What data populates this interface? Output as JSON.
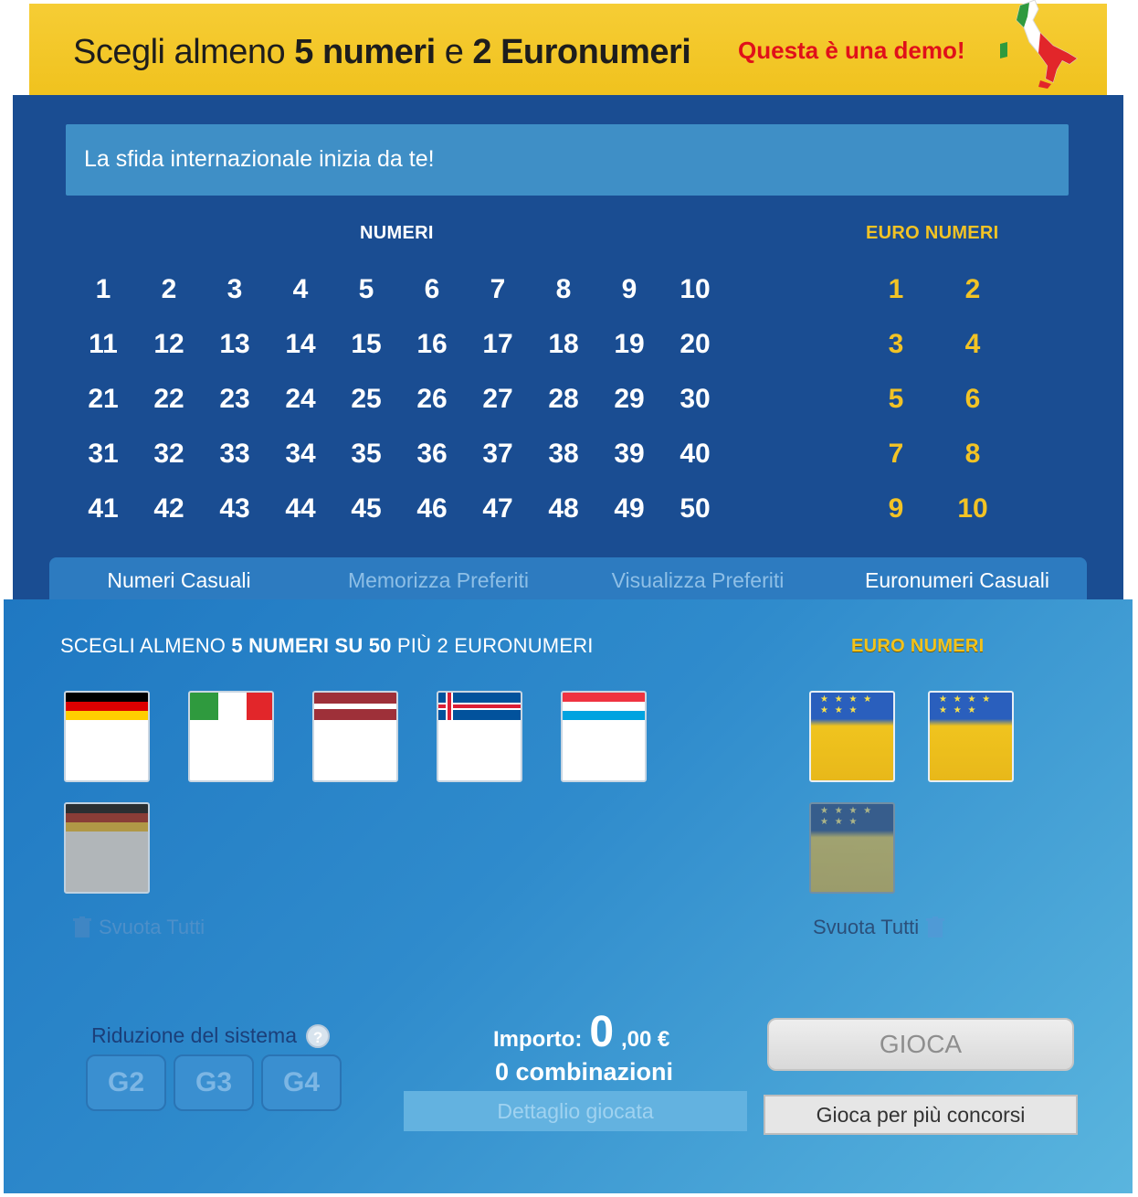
{
  "banner": {
    "title_pre": "Scegli almeno ",
    "title_num5": "5 numeri",
    "title_mid": " e ",
    "title_num2": "2 Euronumeri",
    "demo": "Questa è una demo!"
  },
  "challenge": "La sfida internazionale inizia da te!",
  "numbers_heading": "NUMERI",
  "euro_heading": "EURO NUMERI",
  "numbers": [
    "1",
    "2",
    "3",
    "4",
    "5",
    "6",
    "7",
    "8",
    "9",
    "10",
    "11",
    "12",
    "13",
    "14",
    "15",
    "16",
    "17",
    "18",
    "19",
    "20",
    "21",
    "22",
    "23",
    "24",
    "25",
    "26",
    "27",
    "28",
    "29",
    "30",
    "31",
    "32",
    "33",
    "34",
    "35",
    "36",
    "37",
    "38",
    "39",
    "40",
    "41",
    "42",
    "43",
    "44",
    "45",
    "46",
    "47",
    "48",
    "49",
    "50"
  ],
  "euro_numbers": [
    "1",
    "2",
    "3",
    "4",
    "5",
    "6",
    "7",
    "8",
    "9",
    "10"
  ],
  "tabs": [
    {
      "label": "Numeri Casuali",
      "muted": false
    },
    {
      "label": "Memorizza Preferiti",
      "muted": true
    },
    {
      "label": "Visualizza Preferiti",
      "muted": true
    },
    {
      "label": "Euronumeri Casuali",
      "muted": false
    }
  ],
  "choose": {
    "pre": "SCEGLI ALMENO ",
    "bold": "5 NUMERI SU 50",
    "post": " PIÙ 2 EURONUMERI"
  },
  "euro_heading_lower": "EURO NUMERI",
  "flag_cards": [
    {
      "country": "germany",
      "enabled": true
    },
    {
      "country": "italy",
      "enabled": true
    },
    {
      "country": "latvia",
      "enabled": true
    },
    {
      "country": "iceland",
      "enabled": true
    },
    {
      "country": "luxembourg",
      "enabled": true
    },
    {
      "country": "germany",
      "enabled": false
    }
  ],
  "euro_cards": [
    {
      "enabled": true
    },
    {
      "enabled": true
    },
    {
      "enabled": false
    }
  ],
  "clear_left": "Svuota Tutti",
  "clear_right": "Svuota Tutti",
  "riduzione": "Riduzione del sistema",
  "help": "?",
  "g_buttons": [
    "G2",
    "G3",
    "G4"
  ],
  "importo": {
    "label": "Importo:",
    "value": "0",
    "decimals": ",00 €"
  },
  "combinazioni": "0 combinazioni",
  "dettaglio": "Dettaglio giocata",
  "gioca": "GIOCA",
  "gioca_multi": "Gioca per più concorsi",
  "colors": {
    "banner": "#f0c21e",
    "panel": "#1a4d92",
    "gold": "#f2c325",
    "demo_red": "#e0101a"
  }
}
